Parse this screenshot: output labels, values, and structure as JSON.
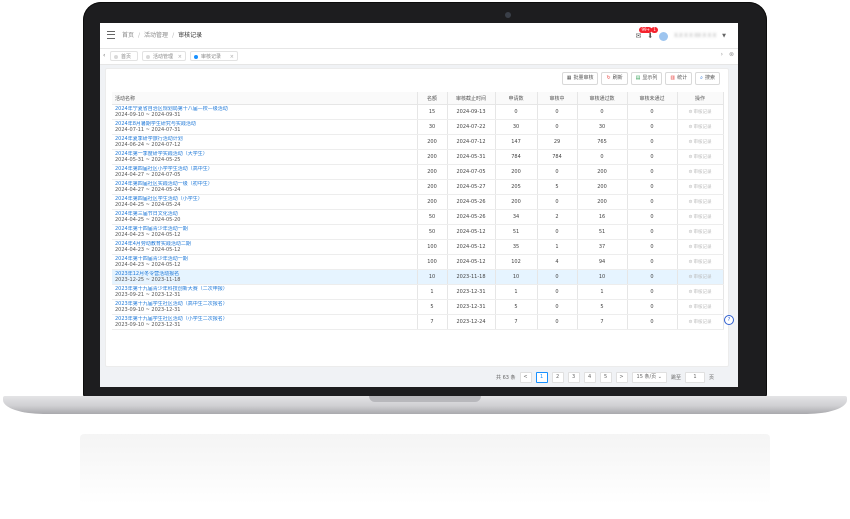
{
  "header": {
    "breadcrumb": [
      "首页",
      "活动管理",
      "审核记录"
    ]
  },
  "user": {
    "name": "X.X X X XX X X X",
    "notice_badge": "99+",
    "download_badge": "1"
  },
  "tabs": [
    {
      "label": "首页",
      "active": false
    },
    {
      "label": "活动管理",
      "active": false
    },
    {
      "label": "审核记录",
      "active": true
    }
  ],
  "toolbar": {
    "btn1": "批量审核",
    "btn2": "刷新",
    "btn3": "显示列",
    "btn4": "统计",
    "btn5": "搜索"
  },
  "columns": {
    "name": "活动名称",
    "c1": "名额",
    "c2": "审核截止时间",
    "c3": "申请数",
    "c4": "审核中",
    "c5": "审核通过数",
    "c6": "审核未通过",
    "op": "操作"
  },
  "rows": [
    {
      "name": "2024年宁夏省自治区规划局第十八届—校—级活动",
      "date": "2024-09-10 ~ 2024-09-31",
      "c1": "15",
      "c2": "2024-09-13",
      "c3": "0",
      "c4": "0",
      "c5": "0",
      "c6": "0",
      "op": "审核记录"
    },
    {
      "name": "2024年8月暑期学生研究与实践活动",
      "date": "2024-07-11 ~ 2024-07-31",
      "c1": "30",
      "c2": "2024-07-22",
      "c3": "30",
      "c4": "0",
      "c5": "30",
      "c6": "0",
      "op": "审核记录"
    },
    {
      "name": "2024年夏季研学旅行活动计划",
      "date": "2024-06-24 ~ 2024-07-12",
      "c1": "200",
      "c2": "2024-07-12",
      "c3": "147",
      "c4": "29",
      "c5": "765",
      "c6": "0",
      "op": "审核记录"
    },
    {
      "name": "2024年第一季度研学实践活动（大学生）",
      "date": "2024-05-31 ~ 2024-05-25",
      "c1": "200",
      "c2": "2024-05-31",
      "c3": "784",
      "c4": "784",
      "c5": "0",
      "c6": "0",
      "op": "审核记录"
    },
    {
      "name": "2024年第四届社区小学学生活动（高中生）",
      "date": "2024-04-27 ~ 2024-07-05",
      "c1": "200",
      "c2": "2024-07-05",
      "c3": "200",
      "c4": "0",
      "c5": "200",
      "c6": "0",
      "op": "审核记录"
    },
    {
      "name": "2024年第四届社区实践活动一级（初中生）",
      "date": "2024-04-27 ~ 2024-05-24",
      "c1": "200",
      "c2": "2024-05-27",
      "c3": "205",
      "c4": "5",
      "c5": "200",
      "c6": "0",
      "op": "审核记录"
    },
    {
      "name": "2024年第四届社区学生活动（小学生）",
      "date": "2024-04-25 ~ 2024-05-24",
      "c1": "200",
      "c2": "2024-05-26",
      "c3": "200",
      "c4": "0",
      "c5": "200",
      "c6": "0",
      "op": "审核记录"
    },
    {
      "name": "2024年第三届节日文化活动",
      "date": "2024-04-25 ~ 2024-05-20",
      "c1": "50",
      "c2": "2024-05-26",
      "c3": "34",
      "c4": "2",
      "c5": "16",
      "c6": "0",
      "op": "审核记录"
    },
    {
      "name": "2024年第十四届青少年活动一期",
      "date": "2024-04-23 ~ 2024-05-12",
      "c1": "50",
      "c2": "2024-05-12",
      "c3": "51",
      "c4": "0",
      "c5": "51",
      "c6": "0",
      "op": "审核记录"
    },
    {
      "name": "2024年4月劳动教育实践活动二期",
      "date": "2024-04-23 ~ 2024-05-12",
      "c1": "100",
      "c2": "2024-05-12",
      "c3": "35",
      "c4": "1",
      "c5": "37",
      "c6": "0",
      "op": "审核记录"
    },
    {
      "name": "2024年第十四届青少年活动一期",
      "date": "2024-04-23 ~ 2024-05-12",
      "c1": "100",
      "c2": "2024-05-12",
      "c3": "102",
      "c4": "4",
      "c5": "94",
      "c6": "0",
      "op": "审核记录"
    },
    {
      "name": "2023年12月冬令营活动报名",
      "date": "2023-12-25 ~ 2023-11-18",
      "c1": "10",
      "c2": "2023-11-18",
      "c3": "10",
      "c4": "0",
      "c5": "10",
      "c6": "0",
      "op": "审核记录",
      "highlight": true
    },
    {
      "name": "2023年第十九届青少年科技创新大赛（二次申报）",
      "date": "2023-09-21 ~ 2023-12-31",
      "c1": "1",
      "c2": "2023-12-31",
      "c3": "1",
      "c4": "0",
      "c5": "1",
      "c6": "0",
      "op": "审核记录"
    },
    {
      "name": "2023年第十九届学生社区活动（高中生二次报名）",
      "date": "2023-09-10 ~ 2023-12-31",
      "c1": "5",
      "c2": "2023-12-31",
      "c3": "5",
      "c4": "0",
      "c5": "5",
      "c6": "0",
      "op": "审核记录"
    },
    {
      "name": "2023年第十九届学生社区活动（小学生二次报名）",
      "date": "2023-09-10 ~ 2023-12-31",
      "c1": "7",
      "c2": "2023-12-24",
      "c3": "7",
      "c4": "0",
      "c5": "7",
      "c6": "0",
      "op": "审核记录"
    }
  ],
  "pagination": {
    "total": "共 63 条",
    "prev": "<",
    "pages": [
      "1",
      "2",
      "3",
      "4",
      "5"
    ],
    "current": "1",
    "next": ">",
    "page_size": "15 条/页",
    "goto": "跳至",
    "goto_value": "1",
    "unit": "页"
  },
  "icons": {
    "menu": "menu-icon",
    "notice": "mail-icon",
    "download": "download-icon",
    "help": "help-icon"
  },
  "colors": {
    "link": "#1e78d8",
    "primary": "#1890ff",
    "highlight_row": "#e6f4ff"
  }
}
